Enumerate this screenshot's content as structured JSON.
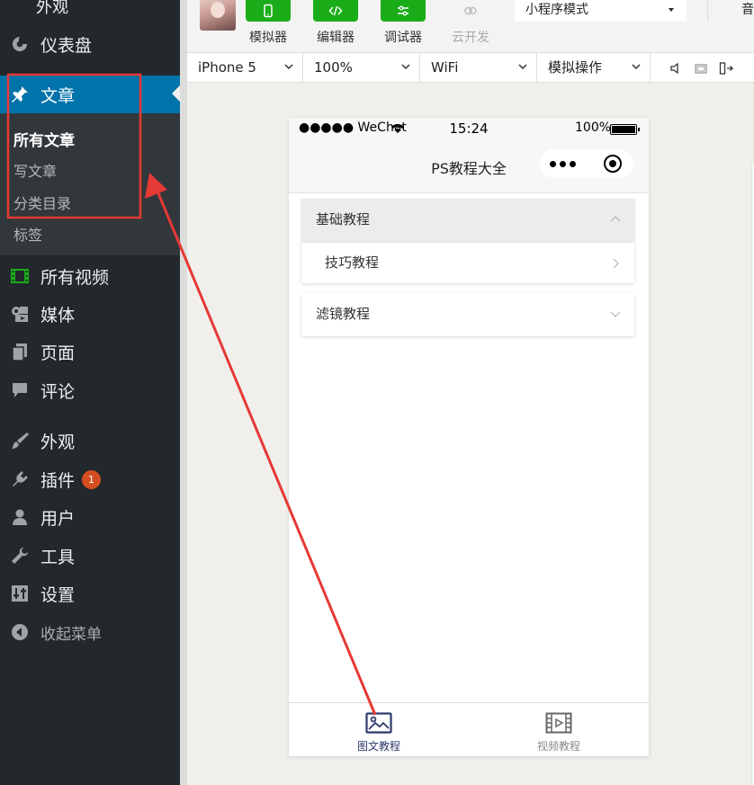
{
  "sidebar": {
    "top_cut_label": "外观",
    "items": [
      {
        "id": "dashboard",
        "label": "仪表盘",
        "icon": "dashboard-icon"
      },
      {
        "id": "posts",
        "label": "文章",
        "icon": "pin-icon",
        "active": true
      },
      {
        "id": "videos",
        "label": "所有视频",
        "icon": "film-icon"
      },
      {
        "id": "media",
        "label": "媒体",
        "icon": "media-icon"
      },
      {
        "id": "pages",
        "label": "页面",
        "icon": "pages-icon"
      },
      {
        "id": "comments",
        "label": "评论",
        "icon": "comment-icon"
      },
      {
        "id": "appearance",
        "label": "外观",
        "icon": "brush-icon"
      },
      {
        "id": "plugins",
        "label": "插件",
        "icon": "plugin-icon",
        "badge": "1"
      },
      {
        "id": "users",
        "label": "用户",
        "icon": "user-icon"
      },
      {
        "id": "tools",
        "label": "工具",
        "icon": "wrench-icon"
      },
      {
        "id": "settings",
        "label": "设置",
        "icon": "settings-icon"
      },
      {
        "id": "collapse",
        "label": "收起菜单",
        "icon": "collapse-icon"
      }
    ],
    "submenu": [
      {
        "label": "所有文章",
        "current": true
      },
      {
        "label": "写文章"
      },
      {
        "label": "分类目录"
      },
      {
        "label": "标签"
      }
    ]
  },
  "toolbar": {
    "tools": [
      {
        "label": "模拟器",
        "icon": "phone-icon"
      },
      {
        "label": "编辑器",
        "icon": "code-icon"
      },
      {
        "label": "调试器",
        "icon": "debug-icon"
      },
      {
        "label": "云开发",
        "icon": "cloud-icon",
        "disabled": true
      }
    ],
    "mode": "小程序模式",
    "cut_label": "音"
  },
  "devicebar": {
    "device": "iPhone 5",
    "zoom": "100%",
    "network": "WiFi",
    "operation": "模拟操作"
  },
  "phone": {
    "status": {
      "carrier": "●●●●● WeChat",
      "time": "15:24",
      "battery": "100%"
    },
    "nav_title": "PS教程大全",
    "panels": [
      {
        "title": "基础教程",
        "open": true,
        "rows": [
          "技巧教程"
        ]
      },
      {
        "title": "滤镜教程",
        "open": false,
        "rows": []
      }
    ],
    "tabs": [
      {
        "label": "图文教程",
        "icon": "image-icon",
        "active": true
      },
      {
        "label": "视频教程",
        "icon": "video-icon",
        "active": false
      }
    ]
  },
  "colors": {
    "sidebar_bg": "#23282d",
    "submenu_bg": "#32373c",
    "active_blue": "#0073aa",
    "tool_green": "#1aad19",
    "badge_orange": "#d54e21",
    "annotation_red": "#e53935",
    "tab_active": "#2e3a6b"
  }
}
